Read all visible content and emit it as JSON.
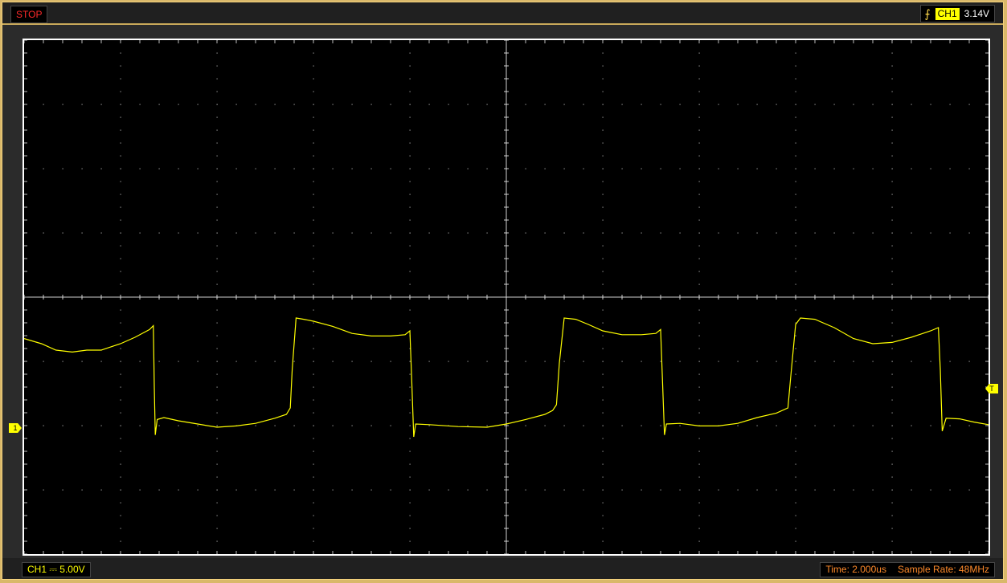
{
  "status": {
    "run_state": "STOP"
  },
  "trigger": {
    "edge_icon": "rising-edge-icon",
    "source": "CH1",
    "level": "3.14V"
  },
  "channel": {
    "name": "CH1",
    "coupling_icon": "dc-coupling-icon",
    "coupling_glyph": "⎓",
    "volts_per_div": "5.00V",
    "color": "#ffff00",
    "marker_label": "1"
  },
  "trigger_marker": {
    "label": "T"
  },
  "timebase": {
    "time_label": "Time: 2.000us",
    "sample_rate_label": "Sample Rate: 48MHz"
  },
  "waveform": {
    "color": "#ffff00",
    "x_unit": "div",
    "y_unit": "div",
    "points": [
      [
        0.0,
        1.38
      ],
      [
        0.18,
        1.3
      ],
      [
        0.33,
        1.2
      ],
      [
        0.5,
        1.17
      ],
      [
        0.65,
        1.2
      ],
      [
        0.8,
        1.2
      ],
      [
        1.0,
        1.3
      ],
      [
        1.15,
        1.4
      ],
      [
        1.3,
        1.52
      ],
      [
        1.34,
        1.58
      ],
      [
        1.35,
        0.62
      ],
      [
        1.36,
        -0.12
      ],
      [
        1.38,
        0.12
      ],
      [
        1.45,
        0.15
      ],
      [
        1.6,
        0.1
      ],
      [
        1.8,
        0.05
      ],
      [
        2.0,
        0.0
      ],
      [
        2.2,
        0.02
      ],
      [
        2.4,
        0.06
      ],
      [
        2.6,
        0.14
      ],
      [
        2.72,
        0.2
      ],
      [
        2.76,
        0.3
      ],
      [
        2.78,
        0.9
      ],
      [
        2.82,
        1.7
      ],
      [
        2.9,
        1.68
      ],
      [
        3.0,
        1.65
      ],
      [
        3.2,
        1.57
      ],
      [
        3.4,
        1.46
      ],
      [
        3.6,
        1.42
      ],
      [
        3.8,
        1.42
      ],
      [
        3.95,
        1.44
      ],
      [
        4.0,
        1.5
      ],
      [
        4.02,
        0.7
      ],
      [
        4.04,
        -0.15
      ],
      [
        4.06,
        0.05
      ],
      [
        4.2,
        0.04
      ],
      [
        4.5,
        0.01
      ],
      [
        4.8,
        0.0
      ],
      [
        5.0,
        0.05
      ],
      [
        5.2,
        0.12
      ],
      [
        5.4,
        0.2
      ],
      [
        5.48,
        0.26
      ],
      [
        5.52,
        0.35
      ],
      [
        5.55,
        1.0
      ],
      [
        5.6,
        1.7
      ],
      [
        5.72,
        1.68
      ],
      [
        5.85,
        1.6
      ],
      [
        6.0,
        1.5
      ],
      [
        6.2,
        1.44
      ],
      [
        6.4,
        1.44
      ],
      [
        6.55,
        1.46
      ],
      [
        6.6,
        1.52
      ],
      [
        6.62,
        0.7
      ],
      [
        6.64,
        -0.12
      ],
      [
        6.66,
        0.05
      ],
      [
        6.8,
        0.06
      ],
      [
        7.0,
        0.02
      ],
      [
        7.2,
        0.02
      ],
      [
        7.4,
        0.06
      ],
      [
        7.6,
        0.15
      ],
      [
        7.8,
        0.22
      ],
      [
        7.92,
        0.3
      ],
      [
        7.95,
        0.8
      ],
      [
        8.0,
        1.6
      ],
      [
        8.05,
        1.7
      ],
      [
        8.2,
        1.68
      ],
      [
        8.4,
        1.55
      ],
      [
        8.6,
        1.38
      ],
      [
        8.8,
        1.3
      ],
      [
        9.0,
        1.32
      ],
      [
        9.2,
        1.4
      ],
      [
        9.4,
        1.5
      ],
      [
        9.48,
        1.55
      ],
      [
        9.5,
        0.9
      ],
      [
        9.52,
        -0.06
      ],
      [
        9.56,
        0.14
      ],
      [
        9.7,
        0.13
      ],
      [
        9.85,
        0.08
      ],
      [
        10.0,
        0.04
      ],
      [
        10.1,
        0.02
      ],
      [
        10.2,
        0.0
      ]
    ]
  }
}
